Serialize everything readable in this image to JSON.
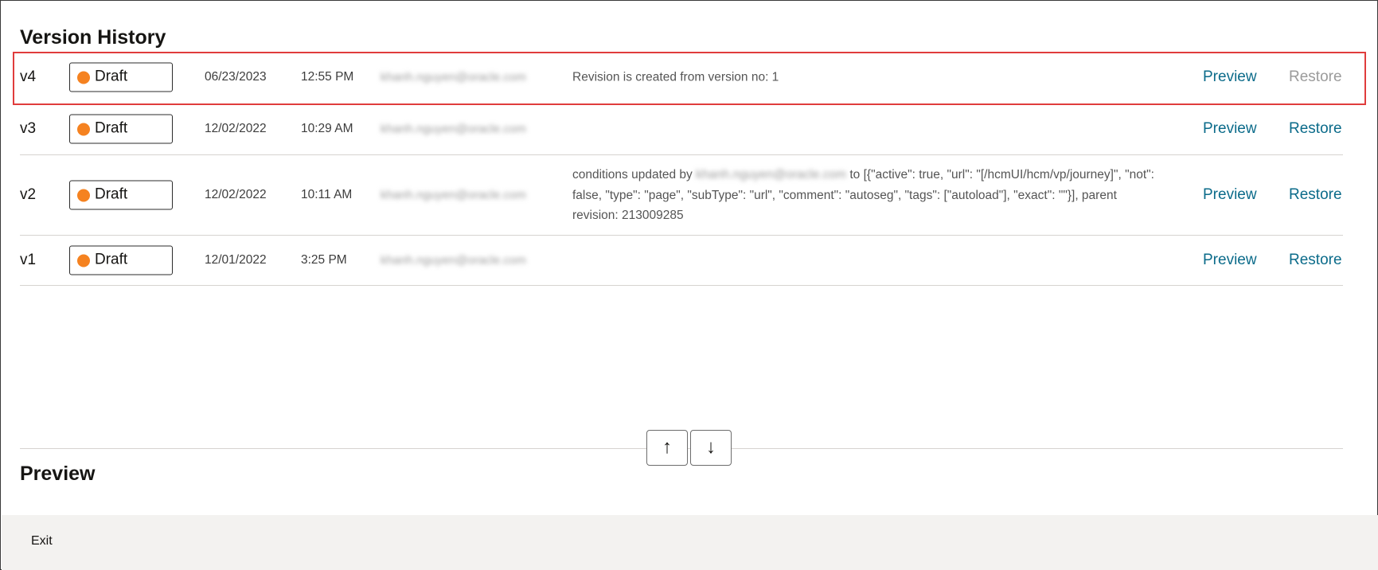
{
  "header": {
    "title": "Version History"
  },
  "versions": [
    {
      "version": "v4",
      "status": "Draft",
      "date": "06/23/2023",
      "time": "12:55 PM",
      "email": "khanh.nguyen@oracle.com",
      "description": "Revision is created from version no: 1",
      "preview_label": "Preview",
      "restore_label": "Restore"
    },
    {
      "version": "v3",
      "status": "Draft",
      "date": "12/02/2022",
      "time": "10:29 AM",
      "email": "khanh.nguyen@oracle.com",
      "description": "",
      "preview_label": "Preview",
      "restore_label": "Restore"
    },
    {
      "version": "v2",
      "status": "Draft",
      "date": "12/02/2022",
      "time": "10:11 AM",
      "email": "khanh.nguyen@oracle.com",
      "description_prefix": "conditions updated by",
      "description_email": "khanh.nguyen@oracle.com",
      "description_suffix": "to [{\"active\": true, \"url\": \"[/hcmUI/hcm/vp/journey]\", \"not\": false, \"type\": \"page\", \"subType\": \"url\", \"comment\": \"autoseg\", \"tags\": [\"autoload\"], \"exact\": \"\"}], parent revision: 213009285",
      "preview_label": "Preview",
      "restore_label": "Restore"
    },
    {
      "version": "v1",
      "status": "Draft",
      "date": "12/01/2022",
      "time": "3:25 PM",
      "email": "khanh.nguyen@oracle.com",
      "description": "",
      "preview_label": "Preview",
      "restore_label": "Restore"
    }
  ],
  "splitter": {
    "up_icon": "↑",
    "down_icon": "↓"
  },
  "preview_section": {
    "title": "Preview"
  },
  "footer": {
    "exit_label": "Exit"
  },
  "colors": {
    "status_dot": "#f58220",
    "link": "#0b6b8a",
    "disabled_link": "#9b9b9b",
    "highlight": "#e03c3c"
  }
}
